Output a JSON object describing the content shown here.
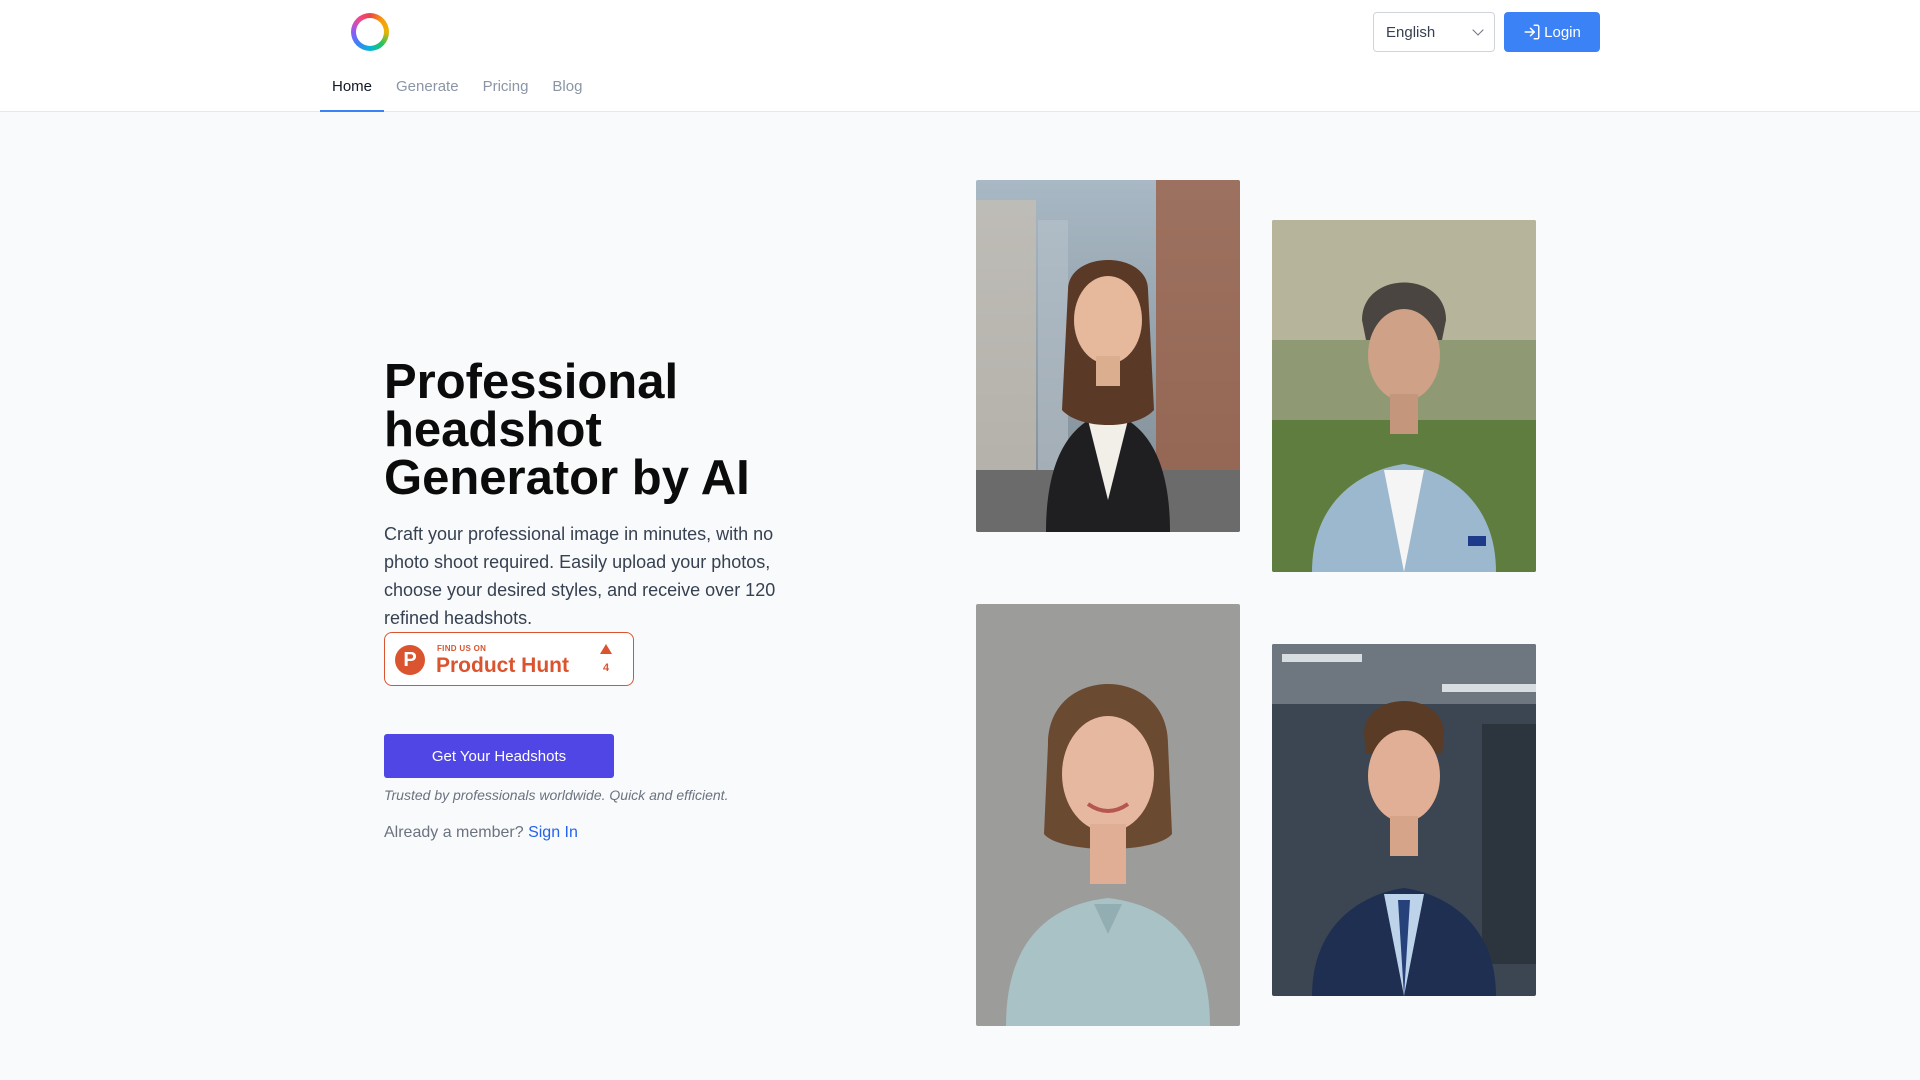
{
  "header": {
    "logo_icon": "rainbow-ring-logo",
    "nav": [
      {
        "label": "Home",
        "active": true
      },
      {
        "label": "Generate",
        "active": false
      },
      {
        "label": "Pricing",
        "active": false
      },
      {
        "label": "Blog",
        "active": false
      }
    ],
    "language": {
      "selected": "English"
    },
    "login_label": "Login"
  },
  "hero": {
    "title_lines": [
      "Professional",
      "headshot",
      "Generator by AI"
    ],
    "description": "Craft your professional image in minutes, with no photo shoot required. Easily upload your photos, choose your desired styles, and receive over 120 refined headshots.",
    "product_hunt": {
      "letter": "P",
      "small_label": "FIND US ON",
      "big_label": "Product Hunt",
      "upvotes": "4"
    },
    "cta_label": "Get Your Headshots",
    "trusted_text": "Trusted by professionals worldwide. Quick and efficient.",
    "member_prefix": "Already a member?",
    "signin_label": "Sign In"
  },
  "colors": {
    "primary_blue": "#3b82f6",
    "cta_indigo": "#4f46e5",
    "product_hunt": "#da552f",
    "link": "#2563eb"
  }
}
